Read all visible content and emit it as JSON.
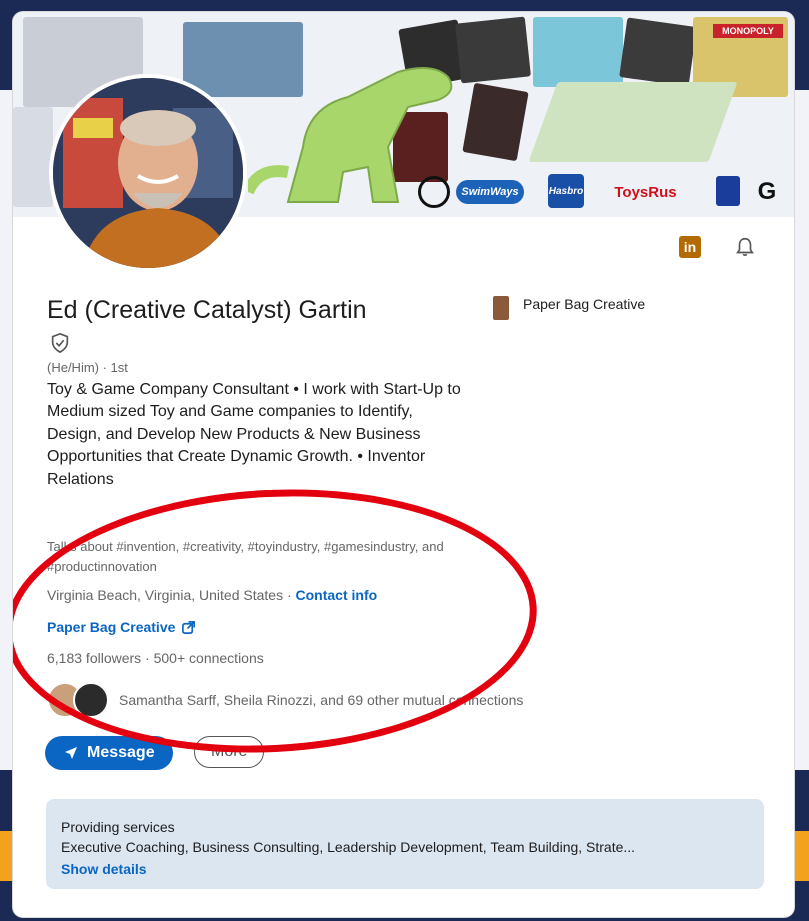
{
  "profile": {
    "name": "Ed (Creative Catalyst) Gartin",
    "pronouns_degree": "(He/Him) · 1st",
    "headline": "Toy & Game Company Consultant • I work with Start-Up to Medium sized Toy and Game companies to Identify, Design, and Develop New Products & New Business Opportunities that Create Dynamic Growth. • Inventor Relations",
    "talks_about": "Talks about #invention, #creativity, #toyindustry, #gamesindustry, and #productinnovation",
    "location": "Virginia Beach, Virginia, United States · ",
    "contact_info": "Contact info",
    "website": "Paper Bag Creative",
    "followers": "6,183 followers · 500+ connections",
    "mutual": "Samantha Sarff, Sheila Rinozzi, and 69 other mutual connections"
  },
  "company": {
    "name": "Paper Bag Creative"
  },
  "actions": {
    "message": "Message",
    "more": "More"
  },
  "services": {
    "label": "Providing services",
    "list": "Executive Coaching, Business Consulting, Leadership Development, Team Building, Strate...",
    "show": "Show details"
  },
  "banner_logos": [
    "SwimWays",
    "Hasbro",
    "ToysRus",
    "MONOPOLY"
  ],
  "icons": [
    "linkedin-icon",
    "bell-icon",
    "verified-shield-icon",
    "send-icon",
    "external-link-icon"
  ],
  "colors": {
    "accent": "#0a66c2",
    "annotation": "#e3000f",
    "services_bg": "#dce6f1"
  }
}
